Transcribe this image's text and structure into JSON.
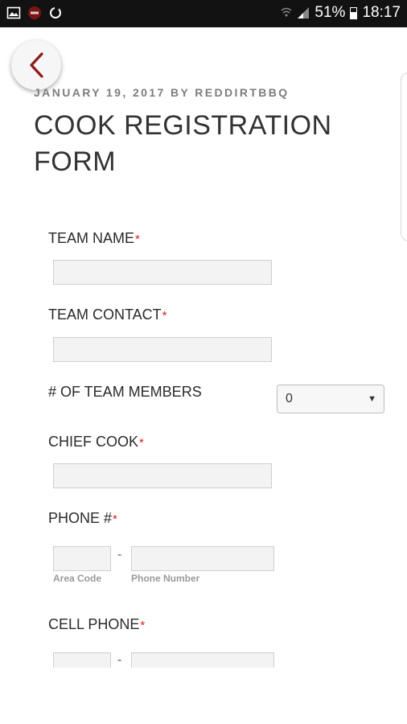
{
  "status_bar": {
    "icons_left": [
      "image-icon",
      "app-icon",
      "sync-icon"
    ],
    "battery": "51%",
    "time": "18:17"
  },
  "post": {
    "meta": "JANUARY 19, 2017 BY REDDIRTBBQ",
    "title": "COOK REGISTRATION FORM"
  },
  "form": {
    "required_mark": "*",
    "team_name": {
      "label": "TEAM NAME",
      "value": ""
    },
    "team_contact": {
      "label": "TEAM CONTACT",
      "value": ""
    },
    "team_members": {
      "label": "# OF TEAM MEMBERS",
      "selected": "0"
    },
    "chief_cook": {
      "label": "CHIEF COOK",
      "value": ""
    },
    "phone": {
      "label": "PHONE #",
      "area_code_label": "Area Code",
      "number_label": "Phone Number",
      "separator": "-"
    },
    "cell_phone": {
      "label": "CELL PHONE",
      "separator": "-"
    }
  },
  "colors": {
    "accent": "#8b1a1a",
    "required": "#d92020",
    "status_bar": "#121212"
  }
}
